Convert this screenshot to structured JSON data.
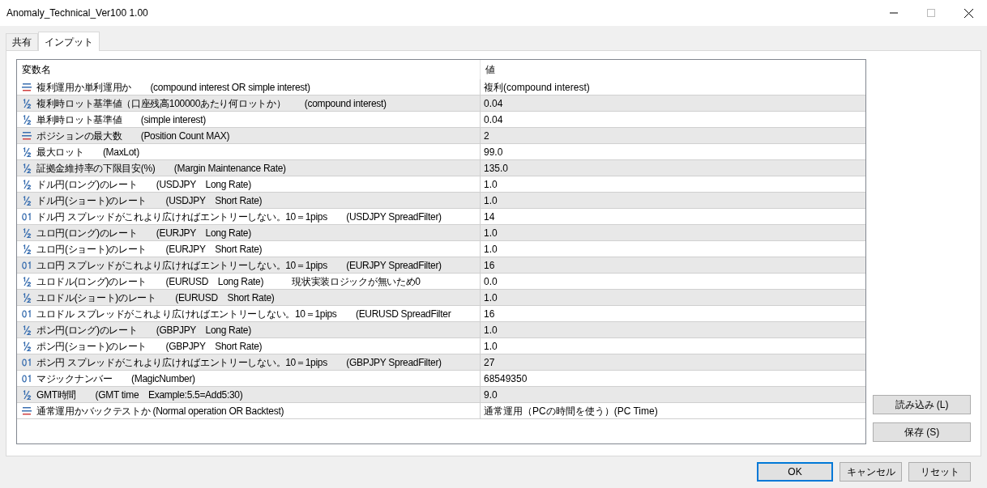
{
  "window": {
    "title": "Anomaly_Technical_Ver100 1.00"
  },
  "tabs": [
    {
      "label": "共有",
      "selected": false
    },
    {
      "label": "インプット",
      "selected": true
    }
  ],
  "table": {
    "columns": [
      "変数名",
      "値"
    ],
    "rows": [
      {
        "kind": "enum",
        "name": "複利運用か単利運用か　　(compound interest OR simple interest)",
        "value": "複利(compound interest)"
      },
      {
        "kind": "double",
        "name": "複利時ロット基準値（口座残高100000あたり何ロットか）　　(compound interest)",
        "value": "0.04"
      },
      {
        "kind": "double",
        "name": "単利時ロット基準値　　(simple interest)",
        "value": "0.04"
      },
      {
        "kind": "enum",
        "name": "ポジションの最大数　　(Position Count MAX)",
        "value": "2"
      },
      {
        "kind": "double",
        "name": "最大ロット　　(MaxLot)",
        "value": "99.0"
      },
      {
        "kind": "double",
        "name": "証拠金維持率の下限目安(%)　　(Margin Maintenance Rate)",
        "value": "135.0"
      },
      {
        "kind": "double",
        "name": "ドル円(ロング)のレート　　(USDJPY　Long Rate)",
        "value": "1.0"
      },
      {
        "kind": "double",
        "name": "ドル円(ショート)のレート　　(USDJPY　Short Rate)",
        "value": "1.0"
      },
      {
        "kind": "int",
        "name": "ドル円 スプレッドがこれより広ければエントリーしない。10＝1pips　　(USDJPY SpreadFilter)",
        "value": "14"
      },
      {
        "kind": "double",
        "name": "ユロ円(ロング)のレート　　(EURJPY　Long Rate)",
        "value": "1.0"
      },
      {
        "kind": "double",
        "name": "ユロ円(ショート)のレート　　(EURJPY　Short Rate)",
        "value": "1.0"
      },
      {
        "kind": "int",
        "name": "ユロ円 スプレッドがこれより広ければエントリーしない。10＝1pips　　(EURJPY SpreadFilter)",
        "value": "16"
      },
      {
        "kind": "double",
        "name": "ユロドル(ロング)のレート　　(EURUSD　Long Rate)　　　現状実装ロジックが無いため0",
        "value": "0.0"
      },
      {
        "kind": "double",
        "name": "ユロドル(ショート)のレート　　(EURUSD　Short Rate)",
        "value": "1.0"
      },
      {
        "kind": "int",
        "name": "ユロドル スプレッドがこれより広ければエントリーしない。10＝1pips　　(EURUSD SpreadFilter",
        "value": "16"
      },
      {
        "kind": "double",
        "name": "ポン円(ロング)のレート　　(GBPJPY　Long Rate)",
        "value": "1.0"
      },
      {
        "kind": "double",
        "name": "ポン円(ショート)のレート　　(GBPJPY　Short Rate)",
        "value": "1.0"
      },
      {
        "kind": "int",
        "name": "ポン円 スプレッドがこれより広ければエントリーしない。10＝1pips　　(GBPJPY SpreadFilter)",
        "value": "27"
      },
      {
        "kind": "int",
        "name": "マジックナンバー　　(MagicNumber)",
        "value": "68549350"
      },
      {
        "kind": "double",
        "name": "GMT時間　　(GMT time　Example:5.5=Add5:30)",
        "value": "9.0"
      },
      {
        "kind": "enum",
        "name": "通常運用かバックテストか (Normal operation OR Backtest)",
        "value": "通常運用（PCの時間を使う）(PC Time)"
      }
    ]
  },
  "side_buttons": [
    "読み込み (L)",
    "保存 (S)"
  ],
  "buttons": [
    {
      "label": "OK",
      "default": true
    },
    {
      "label": "キャンセル",
      "default": false
    },
    {
      "label": "リセット",
      "default": false
    }
  ]
}
